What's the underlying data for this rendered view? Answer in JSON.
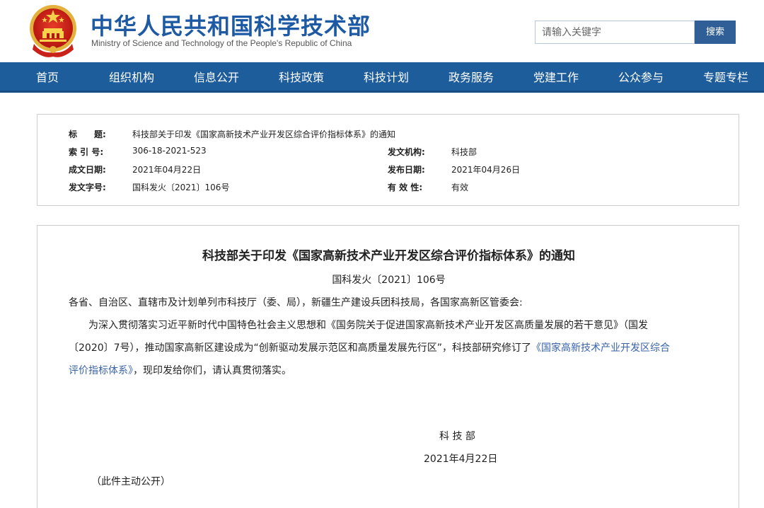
{
  "header": {
    "site_title": "中华人民共和国科学技术部",
    "site_subtitle": "Ministry of Science and Technology of the People's Republic of China",
    "search_placeholder": "请输入关键字",
    "search_button_label": "搜索",
    "emblem_icon": "national-emblem-icon"
  },
  "nav": {
    "items": [
      "首页",
      "组织机构",
      "信息公开",
      "科技政策",
      "科技计划",
      "政务服务",
      "党建工作",
      "公众参与",
      "专题专栏"
    ]
  },
  "meta": {
    "title_label": "标　　题:",
    "title_value": "科技部关于印发《国家高新技术产业开发区综合评价指标体系》的通知",
    "index_label": "索 引 号:",
    "index_value": "306-18-2021-523",
    "issuer_label": "发文机构:",
    "issuer_value": "科技部",
    "created_label": "成文日期:",
    "created_value": "2021年04月22日",
    "published_label": "发布日期:",
    "published_value": "2021年04月26日",
    "docno_label": "发文字号:",
    "docno_value": "国科发火〔2021〕106号",
    "validity_label": "有 效 性:",
    "validity_value": "有效"
  },
  "article": {
    "title": "科技部关于印发《国家高新技术产业开发区综合评价指标体系》的通知",
    "doc_number": "国科发火〔2021〕106号",
    "salutation": "各省、自治区、直辖市及计划单列市科技厅（委、局），新疆生产建设兵团科技局，各国家高新区管委会:",
    "para_line1": "为深入贯彻落实习近平新时代中国特色社会主义思想和《国务院关于促进国家高新技术产业开发区高质量发展的若干意见》（国发",
    "para_line2_plain": "〔2020〕7号），推动国家高新区建设成为“创新驱动发展示范区和高质量发展先行区”，科技部研究修订了",
    "para_line2_link": "《国家高新技术产业开发区综合",
    "para_line3_link": "评价指标体系》",
    "para_line3_plain": "，现印发给你们，请认真贯彻落实。",
    "signature": "科 技 部",
    "date": "2021年4月22日",
    "note": "（此件主动公开）"
  },
  "colors": {
    "brand_blue": "#1d5aa3",
    "nav_blue": "#1e5d9b",
    "link_blue": "#3a63a8"
  }
}
